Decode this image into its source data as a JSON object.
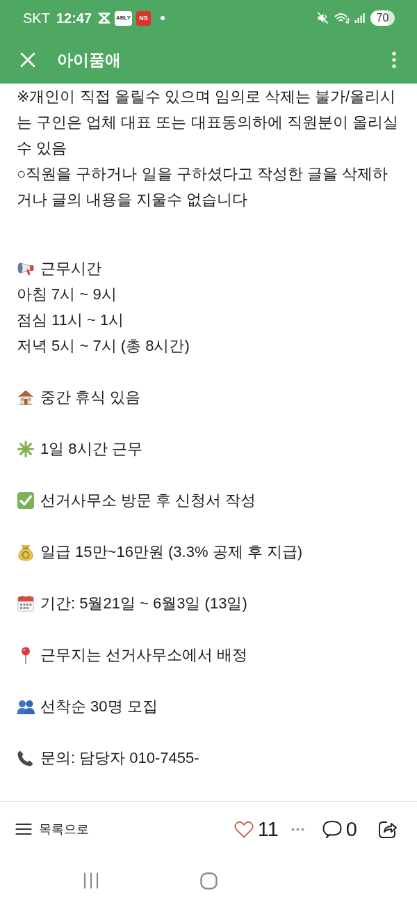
{
  "status_bar": {
    "carrier": "SKT",
    "time": "12:47",
    "notifications": [
      {
        "kind": "glyph"
      },
      {
        "kind": "tile",
        "text": "ABLY",
        "color": "#ffffff"
      },
      {
        "kind": "tile",
        "text": "NS",
        "color": "#d8372b"
      },
      {
        "kind": "dot"
      }
    ],
    "battery": "70"
  },
  "header": {
    "title": "아이품애"
  },
  "post": {
    "notice": [
      "※개인이 직접 올릴수 있으며 임의로 삭제는 불가/올리시는 구인은 업체 대표 또는 대표동의하에 직원분이 올리실수 있음",
      "○직원을 구하거나 일을 구하셨다고 작성한 글을 삭제하거나 글의 내용을 지울수 없습니다"
    ],
    "details": [
      {
        "kind": "megaphone",
        "lines": [
          "근무시간",
          "아침 7시 ~ 9시",
          "점심 11시 ~ 1시",
          "저녁 5시 ~ 7시 (총 8시간)"
        ]
      },
      {
        "kind": "house",
        "lines": [
          "중간 휴식 있음"
        ]
      },
      {
        "kind": "asterisk",
        "lines": [
          "1일 8시간 근무"
        ]
      },
      {
        "kind": "check",
        "lines": [
          "선거사무소 방문 후 신청서 작성"
        ]
      },
      {
        "kind": "money-bag",
        "lines": [
          "일급 15만~16만원 (3.3% 공제 후 지급)"
        ]
      },
      {
        "kind": "calendar",
        "lines": [
          "기간: 5월21일 ~ 6월3일 (13일)"
        ]
      },
      {
        "kind": "pin",
        "lines": [
          "근무지는 선거사무소에서 배정"
        ]
      },
      {
        "kind": "people",
        "lines": [
          "선착순 30명 모집"
        ]
      },
      {
        "kind": "phone",
        "lines": [
          "문의: 담당자 010-7455-"
        ]
      }
    ]
  },
  "bottom_bar": {
    "list_label": "목록으로",
    "likes": "11",
    "comments": "0"
  }
}
